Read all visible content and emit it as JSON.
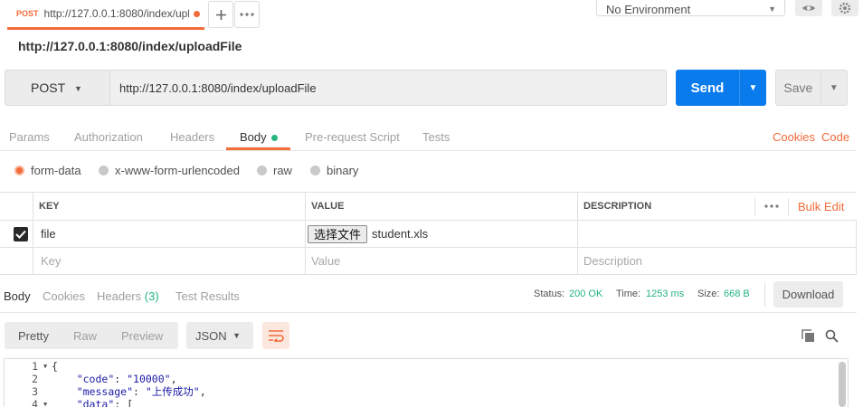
{
  "tabs": {
    "active": {
      "method": "POST",
      "url": "http://127.0.0.1:8080/index/upl"
    },
    "add_icon": "plus-icon",
    "more_icon": "ellipsis-icon"
  },
  "environment": {
    "selected": "No Environment"
  },
  "request": {
    "title": "http://127.0.0.1:8080/index/uploadFile",
    "method": "POST",
    "url": "http://127.0.0.1:8080/index/uploadFile",
    "send_label": "Send",
    "save_label": "Save"
  },
  "request_tabs": {
    "params": "Params",
    "authorization": "Authorization",
    "headers": "Headers",
    "body": "Body",
    "prerequest": "Pre-request Script",
    "tests": "Tests",
    "cookies": "Cookies",
    "code": "Code"
  },
  "body_modes": {
    "form_data": "form-data",
    "urlencoded": "x-www-form-urlencoded",
    "raw": "raw",
    "binary": "binary"
  },
  "params_table": {
    "headers": {
      "key": "KEY",
      "value": "VALUE",
      "description": "DESCRIPTION"
    },
    "bulk_edit": "Bulk Edit",
    "row": {
      "key": "file",
      "file_button": "选择文件",
      "file_name": "student.xls"
    },
    "placeholders": {
      "key": "Key",
      "value": "Value",
      "description": "Description"
    }
  },
  "response_tabs": {
    "body": "Body",
    "cookies": "Cookies",
    "headers": "Headers",
    "headers_count": "(3)",
    "test_results": "Test Results"
  },
  "response_status": {
    "status_label": "Status:",
    "status": "200 OK",
    "time_label": "Time:",
    "time": "1253 ms",
    "size_label": "Size:",
    "size": "668 B",
    "download": "Download"
  },
  "view": {
    "pretty": "Pretty",
    "raw": "Raw",
    "preview": "Preview",
    "format": "JSON"
  },
  "code": {
    "line_numbers": [
      "1",
      "2",
      "3",
      "4"
    ],
    "line1": "{",
    "line2_key": "\"code\"",
    "line2_val": "\"10000\"",
    "line3_key": "\"message\"",
    "line3_val": "\"上传成功\"",
    "line4_key": "\"data\"",
    "line4_rest": ": ["
  },
  "colors": {
    "accent": "#f26b3a",
    "send": "#097bed",
    "success": "#26b47f"
  }
}
